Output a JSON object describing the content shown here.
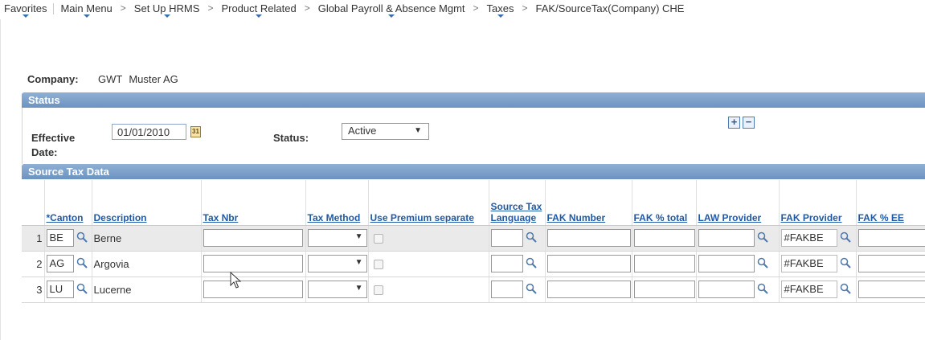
{
  "breadcrumb": {
    "favorites": "Favorites",
    "items": [
      "Main Menu",
      "Set Up HRMS",
      "Product Related",
      "Global Payroll & Absence Mgmt",
      "Taxes",
      "FAK/SourceTax(Company) CHE"
    ],
    "separator": ">"
  },
  "company": {
    "label": "Company:",
    "code": "GWT",
    "name": "Muster AG"
  },
  "status_section": {
    "title": "Status",
    "effective_date_label": "Effective Date:",
    "effective_date_value": "01/01/2010",
    "calendar_glyph": "31",
    "status_label": "Status:",
    "status_value": "Active",
    "add_label": "+",
    "remove_label": "−"
  },
  "source_tax": {
    "title": "Source Tax Data",
    "columns": [
      "*Canton",
      "Description",
      "Tax Nbr",
      "Tax Method",
      "Use Premium separate",
      "Source Tax Language",
      "FAK Number",
      "FAK % total",
      "LAW Provider",
      "FAK Provider",
      "FAK % EE"
    ],
    "rows": [
      {
        "num": "1",
        "canton": "BE",
        "description": "Berne",
        "fak_provider": "#FAKBE"
      },
      {
        "num": "2",
        "canton": "AG",
        "description": "Argovia",
        "fak_provider": "#FAKBE"
      },
      {
        "num": "3",
        "canton": "LU",
        "description": "Lucerne",
        "fak_provider": "#FAKBE"
      }
    ]
  },
  "colors": {
    "section_header": "#7a9dc8",
    "link": "#1e5aa8"
  },
  "icons": {
    "lookup": "magnifier-icon",
    "dropdown": "chevron-down-icon",
    "calendar": "calendar-icon"
  }
}
